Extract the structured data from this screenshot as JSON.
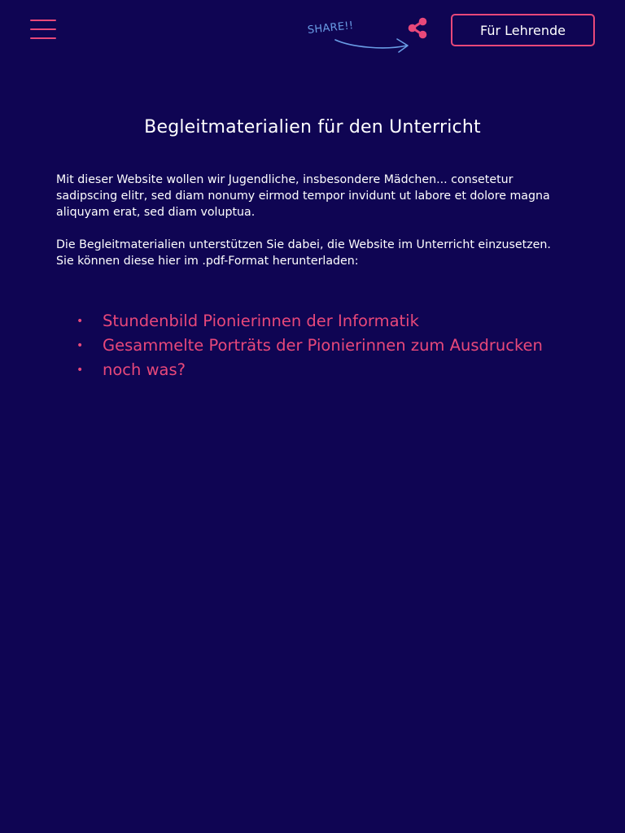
{
  "header": {
    "menu_icon": "hamburger-menu-icon",
    "share_hint": "SHARE!!",
    "share_icon": "share-icon",
    "teacher_button_label": "Für Lehrende"
  },
  "main": {
    "title": "Begleitmaterialien für den Unterricht",
    "intro": "Mit dieser Website wollen wir Jugendliche, insbesondere Mädchen... consetetur sadipscing elitr, sed diam nonumy eirmod tempor invidunt ut labore et dolore magna aliquyam erat, sed diam voluptua.",
    "info": "Die Begleitmaterialien unterstützen Sie dabei, die Website im Unterricht einzusetzen. Sie können diese hier im .pdf-Format herunterladen:",
    "downloads": [
      {
        "label": "Stundenbild Pionierinnen der Informatik"
      },
      {
        "label": "Gesammelte Porträts der Pionierinnen zum Ausdrucken"
      },
      {
        "label": "noch was?"
      }
    ]
  },
  "colors": {
    "background": "#0f0553",
    "accent": "#e8487a",
    "hint": "#6a9de6",
    "text": "#ffffff"
  }
}
